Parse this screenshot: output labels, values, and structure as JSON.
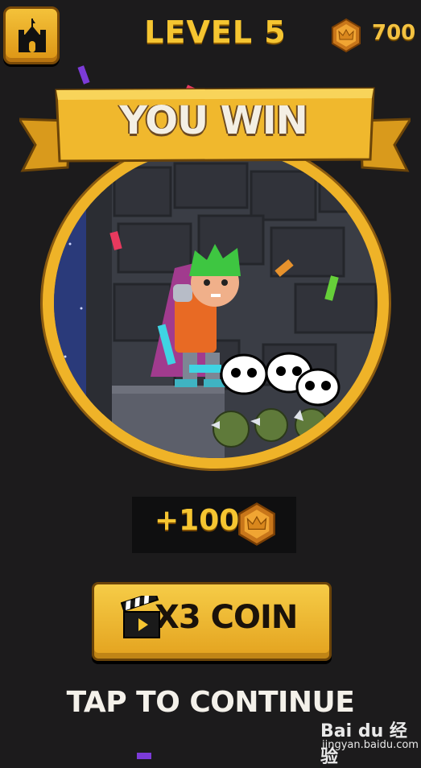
{
  "header": {
    "level_title": "LEVEL 5",
    "coins": "700",
    "home_icon": "castle-icon"
  },
  "banner": {
    "title": "YOU WIN"
  },
  "reward": {
    "amount": "+100",
    "icon": "crown-coin-icon"
  },
  "x3_button": {
    "label": "X3 COIN",
    "icon": "clapperboard-icon"
  },
  "continue": {
    "label": "TAP TO CONTINUE"
  },
  "watermark": {
    "brand": "Bai du 经验",
    "url": "jingyan.baidu.com"
  },
  "colors": {
    "background": "#1c1b1c",
    "gold": "#f5c531",
    "banner": "#f0b82d",
    "ring": "#efb328"
  }
}
